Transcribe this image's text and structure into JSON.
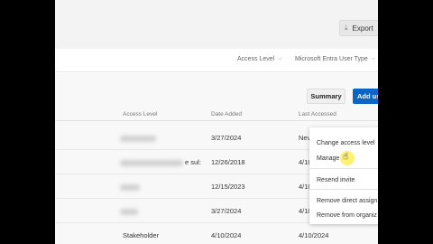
{
  "toolbar": {
    "export_label": "Export",
    "export_icon": "download-icon"
  },
  "filters": [
    {
      "label": "Access Level"
    },
    {
      "label": "Microsoft Entra User Type"
    }
  ],
  "actions": {
    "summary_label": "Summary",
    "add_label": "Add us"
  },
  "table": {
    "columns": [
      "Access Level",
      "Date Added",
      "Last Accessed"
    ],
    "rows": [
      {
        "access_level": "",
        "date_added": "3/27/2024",
        "last_accessed": "Nev"
      },
      {
        "access_level": "e sul:",
        "date_added": "12/26/2018",
        "last_accessed": "4/10"
      },
      {
        "access_level": "",
        "date_added": "12/15/2023",
        "last_accessed": "4/10"
      },
      {
        "access_level": "",
        "date_added": "3/27/2024",
        "last_accessed": "4/10"
      },
      {
        "access_level": "Stakeholder",
        "date_added": "4/10/2024",
        "last_accessed": "4/10/2024"
      }
    ]
  },
  "context_menu": {
    "items": [
      "Change access level",
      "Manage",
      "Resend invite",
      "Remove direct assign",
      "Remove from organiz"
    ]
  }
}
